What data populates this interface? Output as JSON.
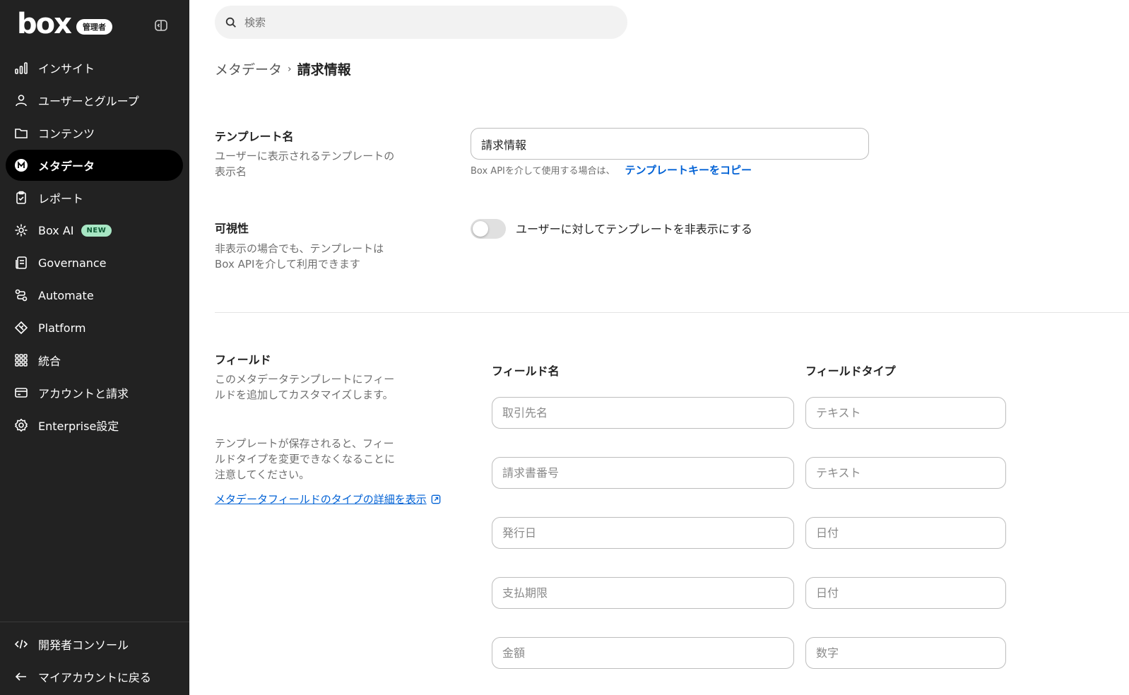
{
  "sidebar": {
    "logo": "box",
    "admin_badge": "管理者",
    "items": [
      {
        "label": "インサイト",
        "icon": "bar-chart-icon"
      },
      {
        "label": "ユーザーとグループ",
        "icon": "user-icon"
      },
      {
        "label": "コンテンツ",
        "icon": "folder-icon"
      },
      {
        "label": "メタデータ",
        "icon": "metadata-icon",
        "active": true
      },
      {
        "label": "レポート",
        "icon": "clipboard-icon"
      },
      {
        "label": "Box AI",
        "icon": "ai-sparkle-icon",
        "badge": "NEW"
      },
      {
        "label": "Governance",
        "icon": "governance-icon"
      },
      {
        "label": "Automate",
        "icon": "automate-icon"
      },
      {
        "label": "Platform",
        "icon": "platform-icon"
      },
      {
        "label": "統合",
        "icon": "grid-icon"
      },
      {
        "label": "アカウントと請求",
        "icon": "card-icon"
      },
      {
        "label": "Enterprise設定",
        "icon": "gear-icon"
      }
    ],
    "bottom_items": [
      {
        "label": "開発者コンソール",
        "icon": "code-icon"
      },
      {
        "label": "マイアカウントに戻る",
        "icon": "arrow-left-icon"
      }
    ]
  },
  "search": {
    "placeholder": "検索"
  },
  "breadcrumb": {
    "parent": "メタデータ",
    "separator": "›",
    "current": "請求情報"
  },
  "template_name": {
    "title": "テンプレート名",
    "desc": "ユーザーに表示されるテンプレートの表示名",
    "value": "請求情報",
    "hint": "Box APIを介して使用する場合は、",
    "copy_link": "テンプレートキーをコピー"
  },
  "visibility": {
    "title": "可視性",
    "desc": "非表示の場合でも、テンプレートはBox APIを介して利用できます",
    "toggle_label": "ユーザーに対してテンプレートを非表示にする",
    "enabled": false
  },
  "fields": {
    "title": "フィールド",
    "desc1": "このメタデータテンプレートにフィールドを追加してカスタマイズします。",
    "desc2": "テンプレートが保存されると、フィールドタイプを変更できなくなることに注意してください。",
    "link": "メタデータフィールドのタイプの詳細を表示",
    "col_name": "フィールド名",
    "col_type": "フィールドタイプ",
    "rows": [
      {
        "name": "取引先名",
        "type": "テキスト"
      },
      {
        "name": "請求書番号",
        "type": "テキスト"
      },
      {
        "name": "発行日",
        "type": "日付"
      },
      {
        "name": "支払期限",
        "type": "日付"
      },
      {
        "name": "金額",
        "type": "数字"
      }
    ]
  },
  "colors": {
    "sidebar_bg": "#222222",
    "link": "#0061d5",
    "new_badge": "#a8e6c4"
  }
}
